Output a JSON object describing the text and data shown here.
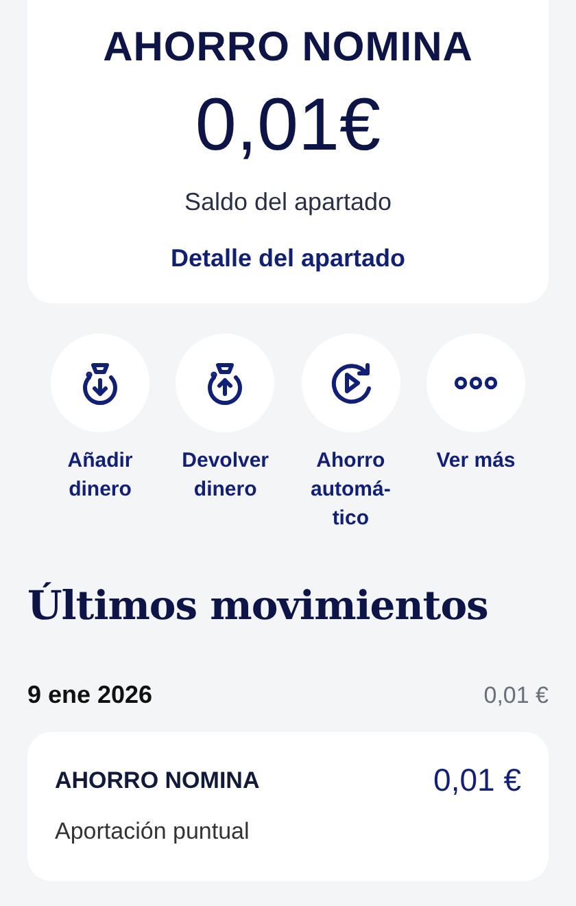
{
  "account": {
    "title": "AHORRO NOMINA",
    "balance": "0,01€",
    "balance_label": "Saldo del apartado",
    "detail_link": "Detalle del apartado"
  },
  "actions": [
    {
      "kind": "add",
      "label": "Añadir dinero"
    },
    {
      "kind": "return",
      "label": "Devolver dinero"
    },
    {
      "kind": "auto",
      "label": "Ahorro automá-tico"
    },
    {
      "kind": "more",
      "label": "Ver más"
    }
  ],
  "movements": {
    "title": "Últimos movimientos",
    "groups": [
      {
        "date": "9 ene 2026",
        "total": "0,01 €",
        "items": [
          {
            "name": "AHORRO NOMINA",
            "amount": "0,01 €",
            "description": "Aportación puntual"
          }
        ]
      }
    ]
  }
}
